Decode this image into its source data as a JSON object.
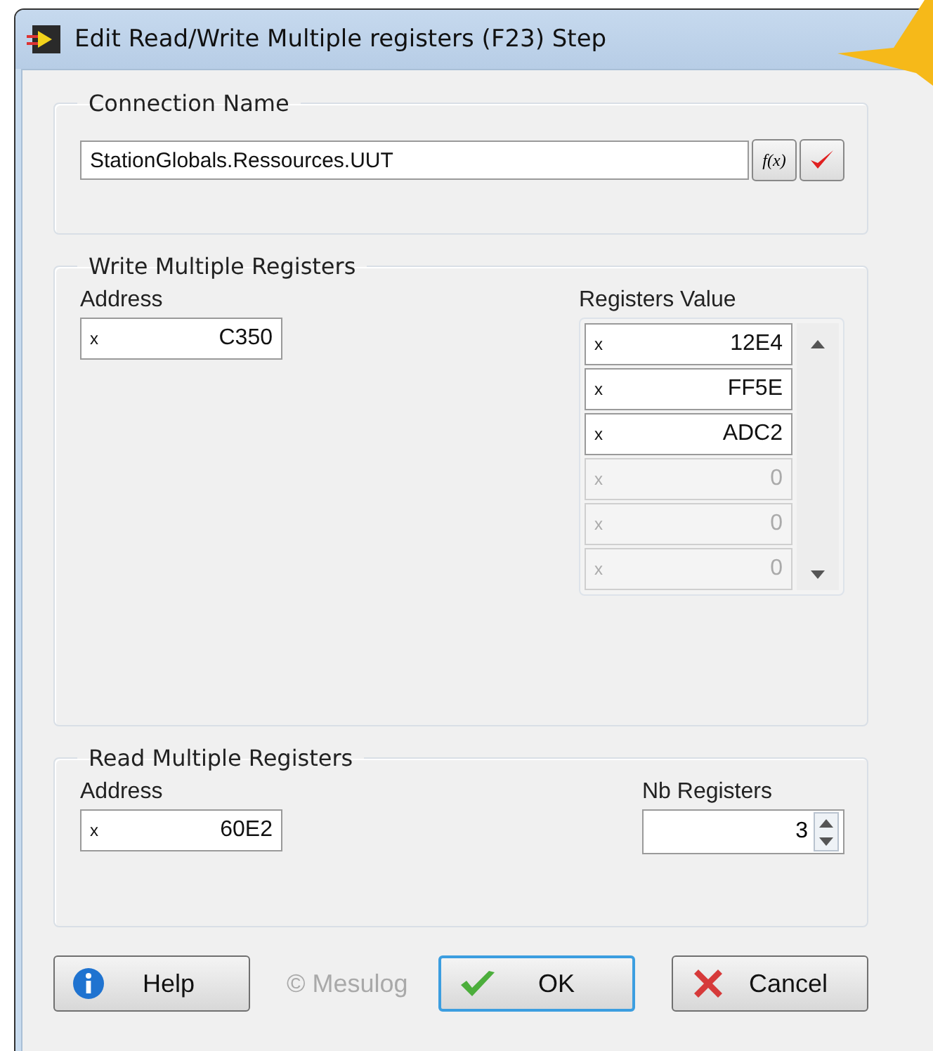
{
  "window": {
    "title": "Edit Read/Write Multiple registers (F23) Step"
  },
  "connection": {
    "legend": "Connection Name",
    "value": "StationGlobals.Ressources.UUT",
    "expression_button": "f(x)"
  },
  "write": {
    "legend": "Write Multiple Registers",
    "address_label": "Address",
    "address": {
      "prefix": "x",
      "value": "C350"
    },
    "registers_label": "Registers Value",
    "registers": [
      {
        "prefix": "x",
        "value": "12E4",
        "disabled": false
      },
      {
        "prefix": "x",
        "value": "FF5E",
        "disabled": false
      },
      {
        "prefix": "x",
        "value": "ADC2",
        "disabled": false
      },
      {
        "prefix": "x",
        "value": "0",
        "disabled": true
      },
      {
        "prefix": "x",
        "value": "0",
        "disabled": true
      },
      {
        "prefix": "x",
        "value": "0",
        "disabled": true
      }
    ]
  },
  "read": {
    "legend": "Read Multiple Registers",
    "address_label": "Address",
    "address": {
      "prefix": "x",
      "value": "60E2"
    },
    "count_label": "Nb Registers",
    "count": "3"
  },
  "footer": {
    "copyright": "© Mesulog"
  },
  "buttons": [
    {
      "kind": "help",
      "label": "Help",
      "selected": false
    },
    {
      "kind": "ok",
      "label": "OK",
      "selected": true
    },
    {
      "kind": "cancel",
      "label": "Cancel",
      "selected": false
    }
  ]
}
